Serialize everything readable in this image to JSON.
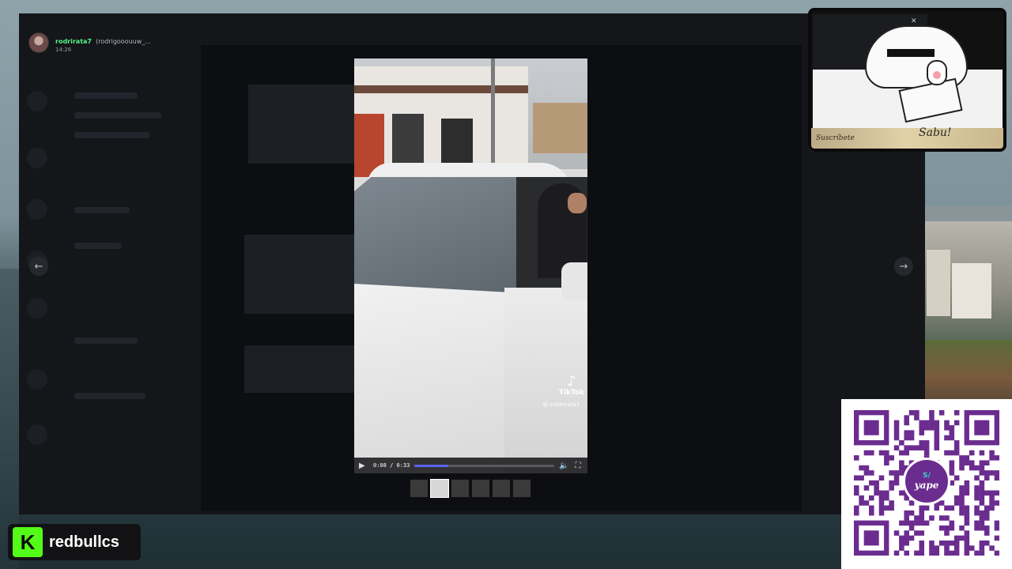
{
  "viewer": {
    "user_name": "rodrirata7",
    "user_handle": "(rodrigooouuw_...",
    "timestamp": "14:26"
  },
  "video": {
    "current_time": "0:08",
    "duration": "0:33",
    "time_display": "0:08 / 0:33",
    "progress": 0.24,
    "watermark_brand": "TikTok",
    "watermark_user": "@ cristorata7"
  },
  "nav": {
    "prev_icon": "arrow-left-icon",
    "next_icon": "arrow-right-icon"
  },
  "thumbnails": {
    "count": 6,
    "active_index": 1
  },
  "overlays": {
    "stream_channel": "redbullcs",
    "qr_brand": "yape",
    "qr_badge_symbol": "S/",
    "cam_sign": "Suscríbete",
    "cam_sign_sub": "Sabu!",
    "accent_green": "#53fc18",
    "qr_purple": "#6b2c8f",
    "discord_blurple": "#5865f2"
  }
}
